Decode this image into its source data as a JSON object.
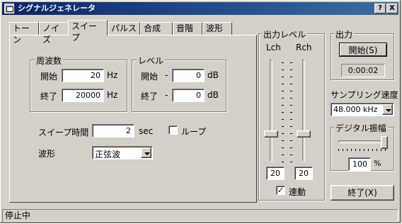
{
  "window": {
    "title": "シグナルジェネレータ",
    "help_btn": "?",
    "close_btn": "X"
  },
  "tabs": [
    {
      "label": "トーン"
    },
    {
      "label": "ノイズ"
    },
    {
      "label": "スイープ",
      "active": true
    },
    {
      "label": "パルス"
    },
    {
      "label": "合成"
    },
    {
      "label": "音階"
    },
    {
      "label": "波形"
    }
  ],
  "sweep": {
    "freq_group": "周波数",
    "start_label": "開始",
    "start_value": "20",
    "start_unit": "Hz",
    "end_label": "終了",
    "end_value": "20000",
    "end_unit": "Hz",
    "level_group": "レベル",
    "level_start_label": "開始",
    "level_start_sign": "-",
    "level_start_value": "0",
    "level_start_unit": "dB",
    "level_end_label": "終了",
    "level_end_sign": "-",
    "level_end_value": "0",
    "level_end_unit": "dB",
    "time_label": "スイープ時間",
    "time_value": "2",
    "time_unit": "sec",
    "loop_label": "ループ",
    "loop_checked": false,
    "wave_label": "波形",
    "wave_value": "正弦波"
  },
  "output_level": {
    "group": "出力レベル",
    "lch": "Lch",
    "rch": "Rch",
    "lch_value": "20",
    "rch_value": "20",
    "link_label": "連動",
    "link_checked": true
  },
  "output": {
    "group": "出力",
    "start_button": "開始(S)",
    "start_mnemonic": "S",
    "time": "0:00:02"
  },
  "sampling": {
    "label": "サンプリング速度",
    "value": "48.000 kHz"
  },
  "digital": {
    "group": "デジタル振幅",
    "value": "100",
    "unit": "%"
  },
  "exit_button": "終了(X)",
  "status": "停止中"
}
